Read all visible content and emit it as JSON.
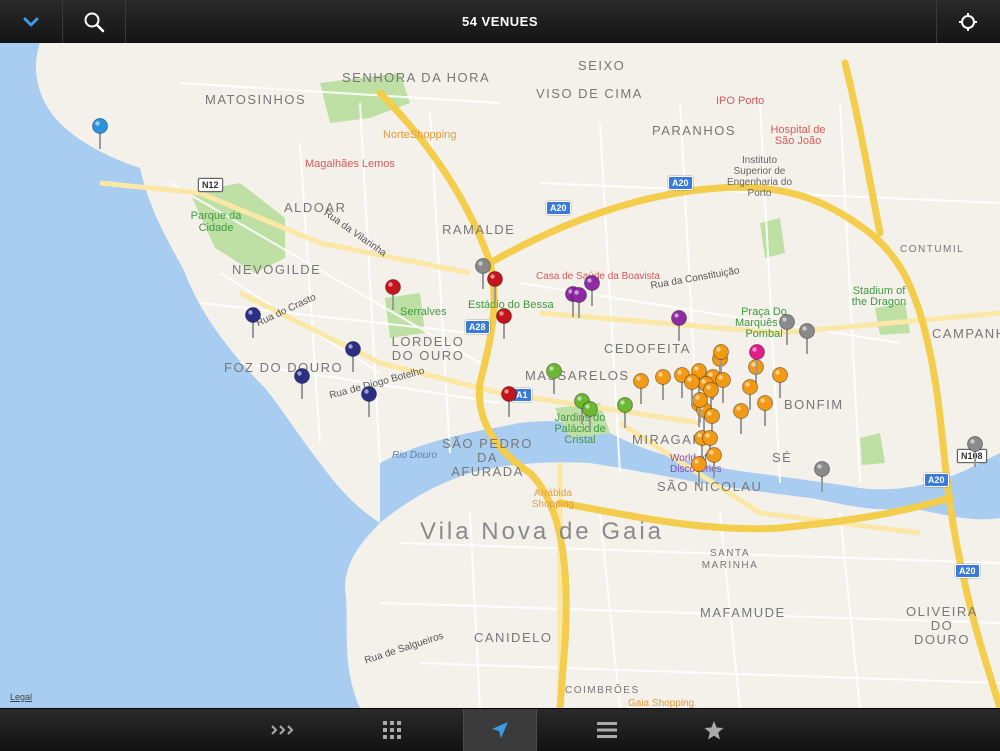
{
  "header": {
    "title": "54 VENUES"
  },
  "map": {
    "areas": [
      "SENHORA DA HORA",
      "SEIXO",
      "MATOSINHOS",
      "VISO DE CIMA",
      "PARANHOS",
      "ALDOAR",
      "RAMALDE",
      "NEVOGILDE",
      "LORDELO DO OURO",
      "CEDOFEITA",
      "FOZ DO DOURO",
      "MASSARELOS",
      "BONFIM",
      "SÃO PEDRO DA AFURADA",
      "MIRAGAIA",
      "SÉ",
      "SÃO NICOLAU",
      "SANTA MARINHA",
      "MAFAMUDE",
      "CANIDELO",
      "OLIVEIRA DO DOURO",
      "CONTUMIL",
      "CAMPANHÃ",
      "COIMBRÕES"
    ],
    "pois": [
      "NorteShopping",
      "Magalhães Lemos",
      "IPO Porto",
      "Hospital de São João",
      "Instituto Superior de Engenharia do Porto",
      "Parque da Cidade",
      "Casa de Saúde da Boavista",
      "Estádio do Bessa",
      "Serralves",
      "Praça Do Marquês de Pombal",
      "Stadium of the Dragon",
      "Jardins do Palácio de Cristal",
      "World of Discoveries",
      "Arrábida Shopping",
      "Gaia Shopping"
    ],
    "roads": [
      "Rua da Vilarinha",
      "Rua do Crasto",
      "Rua de Diogo Botelho",
      "Rua da Constituição",
      "Rio Douro",
      "Rua de Salgueiros"
    ],
    "shields": [
      "N12",
      "A20",
      "A28",
      "A1",
      "N108"
    ],
    "city_label": "Vila Nova de Gaia",
    "legal": "Legal"
  },
  "pins": {
    "colors": {
      "blue": "#2a93e0",
      "navy": "#2b2f86",
      "red": "#c4141c",
      "gray": "#8a8a8a",
      "purple": "#8e2aa3",
      "green": "#6cb833",
      "orange": "#f39a15",
      "pink": "#e21e8c"
    }
  },
  "tabbar": {
    "tabs": [
      {
        "name": "forward-icon",
        "active": false
      },
      {
        "name": "grid-icon",
        "active": false
      },
      {
        "name": "location-arrow-icon",
        "active": true
      },
      {
        "name": "list-icon",
        "active": false
      },
      {
        "name": "star-icon",
        "active": false
      }
    ]
  },
  "colors": {
    "water": "#a8cdf0",
    "land": "#f4f1ea",
    "park": "#bfe0a5",
    "motorway": "#f3cd4b",
    "bar": "#1a1a1a",
    "accent": "#3b9be6"
  }
}
